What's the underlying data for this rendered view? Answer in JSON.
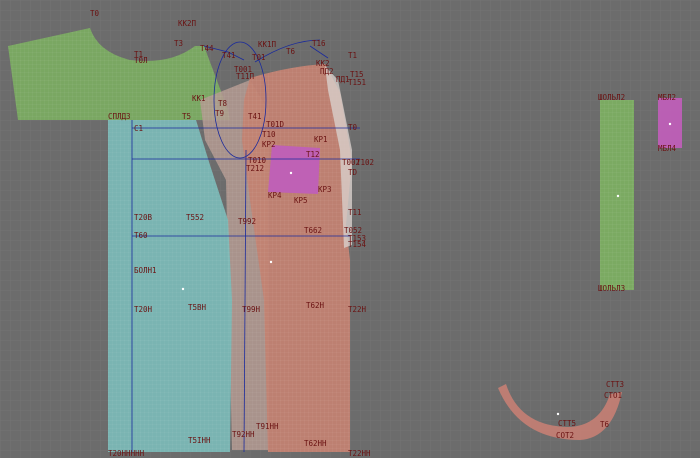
{
  "colors": {
    "background": "#6c6c6c",
    "grid": "#797979",
    "front_piece": "#7cae62",
    "back_piece": "#c28272",
    "sleeve_piece": "#7bb8b6",
    "side_piece": "#b49a92",
    "pocket_piece": "#bf5fb8",
    "strip_piece": "#7cae62",
    "small_piece": "#bf5fb8",
    "collar_piece": "#c27e74",
    "outline": "#1a2a9c",
    "label": "#6a1212"
  },
  "labels": {
    "t0": "T0",
    "kk2p": "KK2П",
    "t3": "T3",
    "t44": "T44",
    "t41": "T41",
    "kk1p": "KK1П",
    "t6": "T6",
    "t16": "T16",
    "t1": "T1",
    "t1p": "T1",
    "t0l": "T0Л",
    "t01": "T01",
    "t001": "T001",
    "t11p": "T11П",
    "kk2": "KK2",
    "pd2": "ПД2",
    "pd1": "ПД1",
    "t151": "T151",
    "t15": "T15",
    "kk1": "KK1",
    "t8": "T8",
    "t5": "T5",
    "t9": "T9",
    "spldz": "СПЛДЗ",
    "t41b": "T41",
    "t01d": "T01D",
    "c1": "C1",
    "t10": "T10",
    "t0r": "T0",
    "kr1": "KP1",
    "kr2": "KP2",
    "t12": "T12",
    "t010": "T010",
    "t212": "T212",
    "t002": "T002",
    "t102": "T102",
    "td": "TD",
    "kr3": "KP3",
    "kr4": "KP4",
    "kr5": "KP5",
    "t20b": "T20B",
    "t552": "T552",
    "t992": "T992",
    "t11": "T11",
    "t60": "T60",
    "t662": "T662",
    "t052": "T052",
    "t153": "T153",
    "t154": "T154",
    "boln1": "БОЛН1",
    "t20n": "T20H",
    "t5bn": "T5BH",
    "t99n": "T99H",
    "t62n": "T62H",
    "t22n": "T22H",
    "t91nn": "T91HH",
    "t92nn": "T92HH",
    "t5inn": "T5IHH",
    "t62nn": "T62HH",
    "t22nn": "T22HH",
    "t20nn": "T20HHHHH",
    "strip_top": "ШОЛЬЛ2",
    "strip_bottom": "ШОЛЬЛЗ",
    "small_top": "MБЛ2",
    "small_bottom": "MБЛ4",
    "stt3": "СТТ3",
    "sto1": "СТО1",
    "stt5": "СТТ5",
    "sot2": "СОТ2",
    "tt6": "T6"
  }
}
